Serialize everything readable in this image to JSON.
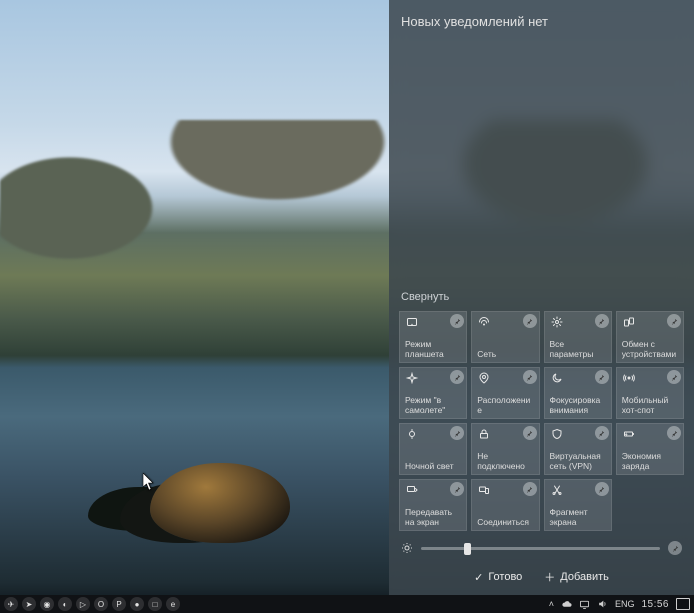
{
  "panel": {
    "title": "Новых уведомлений нет",
    "collapse": "Свернуть",
    "done": "Готово",
    "add": "Добавить"
  },
  "tiles": [
    {
      "id": "tablet-mode",
      "label": "Режим планшета",
      "icon": "tablet"
    },
    {
      "id": "network",
      "label": "Сеть",
      "icon": "network"
    },
    {
      "id": "all-settings",
      "label": "Все параметры",
      "icon": "gear"
    },
    {
      "id": "share",
      "label": "Обмен с устройствами",
      "icon": "share"
    },
    {
      "id": "airplane-mode",
      "label": "Режим \"в самолете\"",
      "icon": "airplane"
    },
    {
      "id": "location",
      "label": "Расположение",
      "icon": "location"
    },
    {
      "id": "focus-assist",
      "label": "Фокусировка внимания",
      "icon": "moon"
    },
    {
      "id": "hotspot",
      "label": "Мобильный хот-спот",
      "icon": "hotspot"
    },
    {
      "id": "night-light",
      "label": "Ночной свет",
      "icon": "nightlight"
    },
    {
      "id": "vpn-disc",
      "label": "Не подключено",
      "icon": "vpn"
    },
    {
      "id": "vpn-net",
      "label": "Виртуальная сеть (VPN)",
      "icon": "shield"
    },
    {
      "id": "battery-saver",
      "label": "Экономия заряда",
      "icon": "battery"
    },
    {
      "id": "project",
      "label": "Передавать на экран",
      "icon": "project"
    },
    {
      "id": "connect",
      "label": "Соединиться",
      "icon": "connect"
    },
    {
      "id": "snip",
      "label": "Фрагмент экрана",
      "icon": "snip"
    }
  ],
  "brightness": {
    "value": 18
  },
  "taskbar": {
    "left_icons": [
      "telegram",
      "paperplane",
      "chrome",
      "steam",
      "media",
      "opera",
      "pinterest",
      "circle",
      "window",
      "edge"
    ],
    "tray": {
      "chevron": "˄",
      "lang": "ENG",
      "clock": "15:56"
    }
  }
}
